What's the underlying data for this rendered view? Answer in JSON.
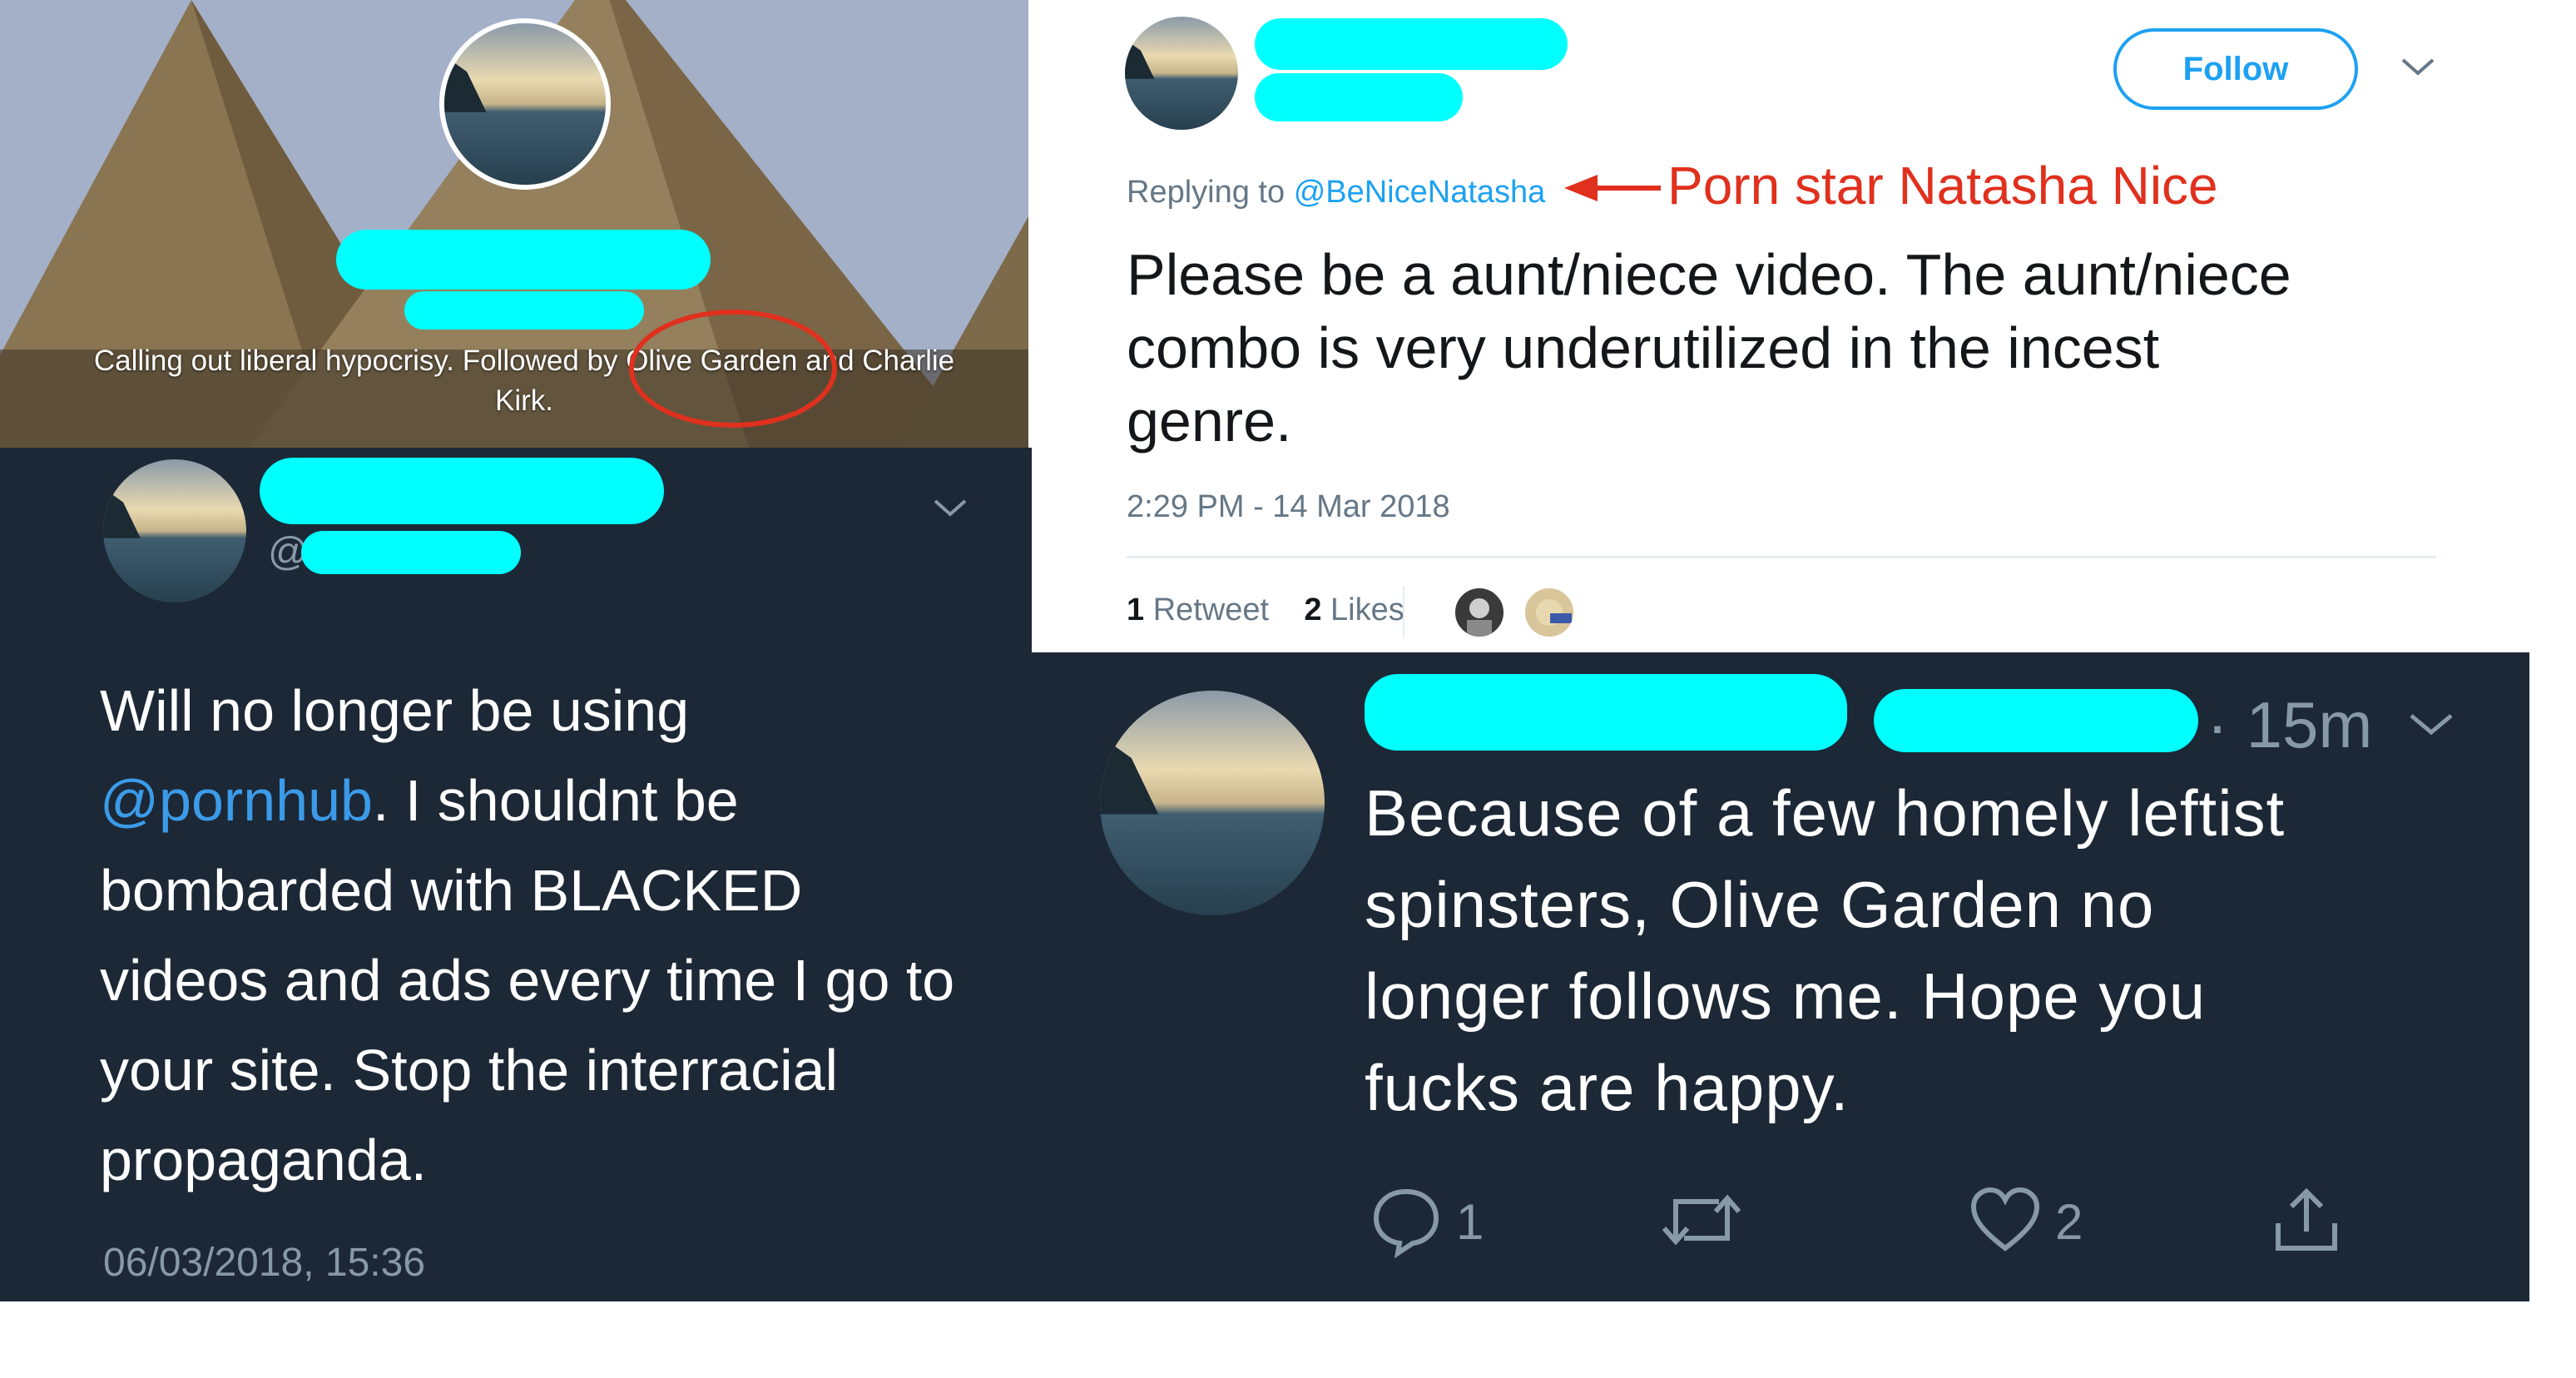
{
  "profile_header": {
    "bio_line1": "Calling out liberal hypocrisy. Followed by Olive Garden and Charlie",
    "bio_line2": "Kirk."
  },
  "tweet_light": {
    "follow_label": "Follow",
    "replying_prefix": "Replying to",
    "replying_handle": "@BeNiceNatasha",
    "annotation": "Porn star Natasha Nice",
    "text_line1": "Please be a aunt/niece video. The aunt/niece",
    "text_line2": "combo is very underutilized in the incest",
    "text_line3": "genre.",
    "timestamp": "2:29 PM - 14 Mar 2018",
    "retweets_count": "1",
    "retweets_label": "Retweet",
    "likes_count": "2",
    "likes_label": "Likes"
  },
  "tweet_dark_left": {
    "handle_prefix": "@",
    "text_line1": "Will no longer be using",
    "mention": "@pornhub",
    "text_line2_rest": ". I shouldnt be",
    "text_line3": "bombarded with BLACKED",
    "text_line4": "videos and ads every time I go to",
    "text_line5": "your site. Stop the interracial",
    "text_line6": "propaganda.",
    "timestamp": "06/03/2018, 15:36"
  },
  "tweet_dark_right": {
    "time": "· 15m",
    "text_line1": "Because of a few homely leftist",
    "text_line2": "spinsters, Olive Garden no",
    "text_line3": "longer follows me. Hope you",
    "text_line4": "fucks are happy.",
    "reply_count": "1",
    "like_count": "2"
  },
  "colors": {
    "twitter_blue": "#1da1f2",
    "dark_background": "#1c2836",
    "redaction": "#00ffff",
    "annotation_red": "#e0301e"
  },
  "icons": [
    "chevron-down-icon",
    "reply-icon",
    "retweet-icon",
    "heart-icon",
    "share-icon",
    "arrow-left-icon"
  ]
}
